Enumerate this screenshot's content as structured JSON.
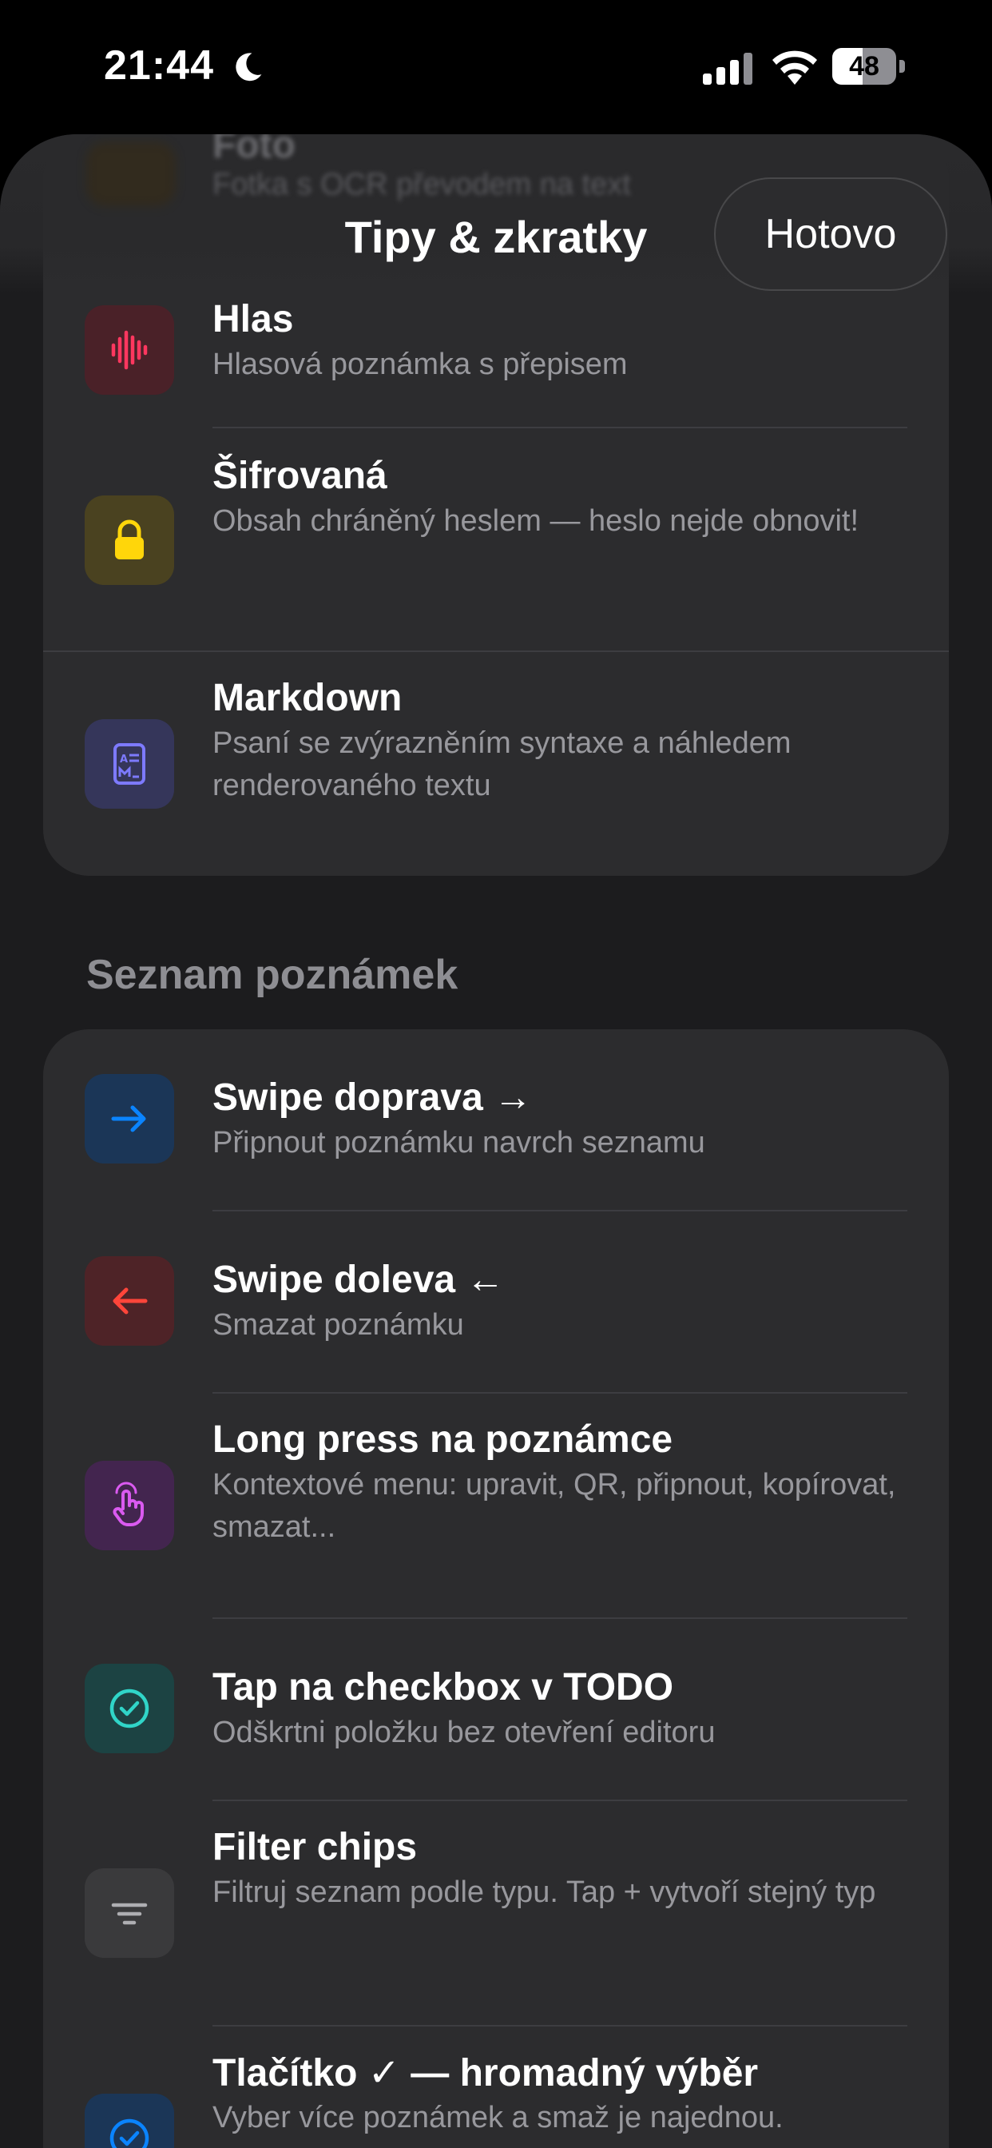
{
  "status_bar": {
    "time": "21:44",
    "battery": "48",
    "battery_level": 0.48
  },
  "nav": {
    "title": "Tipy & zkratky",
    "done_label": "Hotovo"
  },
  "ghost_row": {
    "title": "Foto",
    "subtitle": "Fotka s OCR převodem na text"
  },
  "group_top": {
    "rows": [
      {
        "title": "Hlas",
        "subtitle": "Hlasová poznámka s přepisem",
        "icon": "waveform-icon",
        "color": "#ff375f"
      },
      {
        "title": "Šifrovaná",
        "subtitle": "Obsah chráněný heslem — heslo nejde obnovit!",
        "icon": "lock-icon",
        "color": "#ffd60a"
      },
      {
        "title": "Markdown",
        "subtitle": "Psaní se zvýrazněním syntaxe a náhledem renderovaného textu",
        "icon": "markdown-doc-icon",
        "color": "#7d7aff"
      }
    ]
  },
  "section": {
    "header": "Seznam poznámek"
  },
  "group_list": {
    "rows": [
      {
        "title": "Swipe doprava →",
        "subtitle": "Připnout poznámku navrch seznamu",
        "icon": "arrow-right-icon",
        "color": "#0a84ff"
      },
      {
        "title": "Swipe doleva ←",
        "subtitle": "Smazat poznámku",
        "icon": "arrow-left-icon",
        "color": "#ff453a"
      },
      {
        "title": "Long press na poznámce",
        "subtitle": "Kontextové menu: upravit, QR, připnout, kopírovat, smazat...",
        "icon": "hand-tap-icon",
        "color": "#da5af0"
      },
      {
        "title": "Tap na checkbox v TODO",
        "subtitle": "Odškrtni položku bez otevření editoru",
        "icon": "checkmark-circle-icon",
        "color": "#30d5c8"
      },
      {
        "title": "Filter chips",
        "subtitle": "Filtruj seznam podle typu. Tap + vytvoří stejný typ",
        "icon": "filter-lines-icon",
        "color": "#aeaeb2"
      },
      {
        "title": "Tlačítko ✓ — hromadný výběr",
        "subtitle": "Vyber více poznámek a smaž je najednou.",
        "icon": "checkmark-circle-icon",
        "color": "#0a84ff"
      }
    ]
  }
}
